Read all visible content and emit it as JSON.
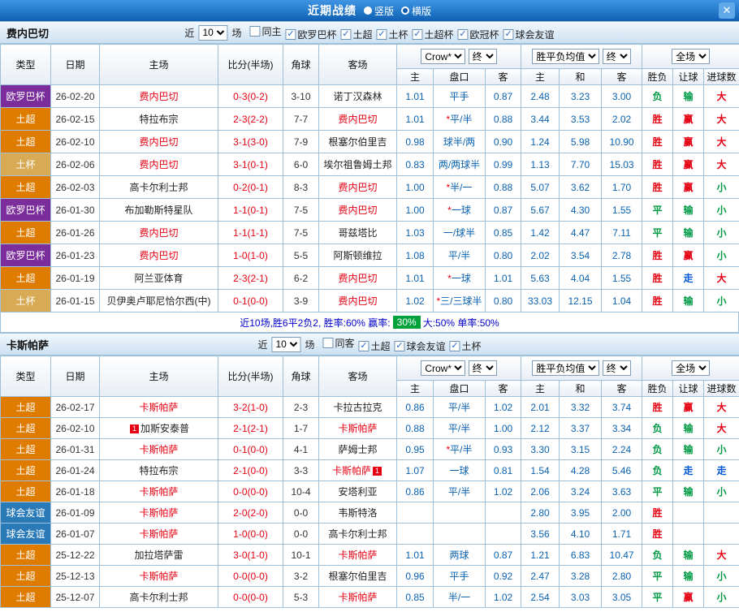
{
  "header": {
    "title": "近期战绩",
    "layout_options": [
      {
        "label": "竖版",
        "selected": false
      },
      {
        "label": "横版",
        "selected": true
      }
    ],
    "close_label": "✕"
  },
  "colors": {
    "type": {
      "欧罗巴杯": "#7c2d9c",
      "土超": "#df7c00",
      "土杯": "#d9aa55",
      "球会友谊": "#2a7ab8"
    },
    "result": {
      "r": "#e60012",
      "g": "#009944",
      "b": "#0056d6"
    },
    "accent_blue": "#0a62b0",
    "score_red": "#e60012"
  },
  "table_header": {
    "type": "类型",
    "date": "日期",
    "home": "主场",
    "score": "比分(半场)",
    "corner": "角球",
    "away": "客场",
    "odds_select": "Crow*",
    "odds_final": "终",
    "avg_select": "胜平负均值",
    "avg_final": "终",
    "full_select": "全场",
    "odds_subs": [
      "主",
      "盘口",
      "客"
    ],
    "avg_subs": [
      "主",
      "和",
      "客"
    ],
    "full_subs": [
      "胜负",
      "让球",
      "进球数"
    ]
  },
  "sections": [
    {
      "team": "费内巴切",
      "near_label": "近",
      "near_value": "10",
      "games_label": "场",
      "filters": [
        {
          "label": "同主",
          "checked": false
        },
        {
          "label": "欧罗巴杯",
          "checked": true
        },
        {
          "label": "土超",
          "checked": true
        },
        {
          "label": "土杯",
          "checked": true
        },
        {
          "label": "土超杯",
          "checked": true
        },
        {
          "label": "欧冠杯",
          "checked": true
        },
        {
          "label": "球会友谊",
          "checked": true
        }
      ],
      "rows": [
        {
          "type": "欧罗巴杯",
          "date": "26-02-20",
          "home": {
            "name": "费内巴切",
            "focus": true
          },
          "score": "0-3(0-2)",
          "corner": "3-10",
          "away": {
            "name": "诺丁汉森林"
          },
          "odds": [
            "1.01",
            "平手",
            "0.87"
          ],
          "avg": [
            "2.48",
            "3.23",
            "3.00"
          ],
          "results": [
            {
              "t": "负",
              "c": "g"
            },
            {
              "t": "输",
              "c": "g"
            },
            {
              "t": "大",
              "c": "r"
            }
          ]
        },
        {
          "type": "土超",
          "date": "26-02-15",
          "home": {
            "name": "特拉布宗"
          },
          "score": "2-3(2-2)",
          "corner": "7-7",
          "away": {
            "name": "费内巴切",
            "focus": true
          },
          "odds": [
            "1.01",
            "*平/半",
            "0.88"
          ],
          "avg": [
            "3.44",
            "3.53",
            "2.02"
          ],
          "results": [
            {
              "t": "胜",
              "c": "r"
            },
            {
              "t": "赢",
              "c": "r"
            },
            {
              "t": "大",
              "c": "r"
            }
          ]
        },
        {
          "type": "土超",
          "date": "26-02-10",
          "home": {
            "name": "费内巴切",
            "focus": true
          },
          "score": "3-1(3-0)",
          "corner": "7-9",
          "away": {
            "name": "根塞尔伯里吉"
          },
          "odds": [
            "0.98",
            "球半/两",
            "0.90"
          ],
          "avg": [
            "1.24",
            "5.98",
            "10.90"
          ],
          "results": [
            {
              "t": "胜",
              "c": "r"
            },
            {
              "t": "赢",
              "c": "r"
            },
            {
              "t": "大",
              "c": "r"
            }
          ]
        },
        {
          "type": "土杯",
          "date": "26-02-06",
          "home": {
            "name": "费内巴切",
            "focus": true
          },
          "score": "3-1(0-1)",
          "corner": "6-0",
          "away": {
            "name": "埃尔祖鲁姆土邦"
          },
          "odds": [
            "0.83",
            "两/两球半",
            "0.99"
          ],
          "avg": [
            "1.13",
            "7.70",
            "15.03"
          ],
          "results": [
            {
              "t": "胜",
              "c": "r"
            },
            {
              "t": "赢",
              "c": "r"
            },
            {
              "t": "大",
              "c": "r"
            }
          ]
        },
        {
          "type": "土超",
          "date": "26-02-03",
          "home": {
            "name": "高卡尔利士邦"
          },
          "score": "0-2(0-1)",
          "corner": "8-3",
          "away": {
            "name": "费内巴切",
            "focus": true
          },
          "odds": [
            "1.00",
            "*半/一",
            "0.88"
          ],
          "avg": [
            "5.07",
            "3.62",
            "1.70"
          ],
          "results": [
            {
              "t": "胜",
              "c": "r"
            },
            {
              "t": "赢",
              "c": "r"
            },
            {
              "t": "小",
              "c": "g"
            }
          ]
        },
        {
          "type": "欧罗巴杯",
          "date": "26-01-30",
          "home": {
            "name": "布加勒斯特星队"
          },
          "score": "1-1(0-1)",
          "corner": "7-5",
          "away": {
            "name": "费内巴切",
            "focus": true
          },
          "odds": [
            "1.00",
            "*一球",
            "0.87"
          ],
          "avg": [
            "5.67",
            "4.30",
            "1.55"
          ],
          "results": [
            {
              "t": "平",
              "c": "g"
            },
            {
              "t": "输",
              "c": "g"
            },
            {
              "t": "小",
              "c": "g"
            }
          ]
        },
        {
          "type": "土超",
          "date": "26-01-26",
          "home": {
            "name": "费内巴切",
            "focus": true
          },
          "score": "1-1(1-1)",
          "corner": "7-5",
          "away": {
            "name": "哥兹塔比"
          },
          "odds": [
            "1.03",
            "一/球半",
            "0.85"
          ],
          "avg": [
            "1.42",
            "4.47",
            "7.11"
          ],
          "results": [
            {
              "t": "平",
              "c": "g"
            },
            {
              "t": "输",
              "c": "g"
            },
            {
              "t": "小",
              "c": "g"
            }
          ]
        },
        {
          "type": "欧罗巴杯",
          "date": "26-01-23",
          "home": {
            "name": "费内巴切",
            "focus": true
          },
          "score": "1-0(1-0)",
          "corner": "5-5",
          "away": {
            "name": "阿斯顿维拉"
          },
          "odds": [
            "1.08",
            "平/半",
            "0.80"
          ],
          "avg": [
            "2.02",
            "3.54",
            "2.78"
          ],
          "results": [
            {
              "t": "胜",
              "c": "r"
            },
            {
              "t": "赢",
              "c": "r"
            },
            {
              "t": "小",
              "c": "g"
            }
          ]
        },
        {
          "type": "土超",
          "date": "26-01-19",
          "home": {
            "name": "阿兰亚体育"
          },
          "score": "2-3(2-1)",
          "corner": "6-2",
          "away": {
            "name": "费内巴切",
            "focus": true
          },
          "odds": [
            "1.01",
            "*一球",
            "1.01"
          ],
          "avg": [
            "5.63",
            "4.04",
            "1.55"
          ],
          "results": [
            {
              "t": "胜",
              "c": "r"
            },
            {
              "t": "走",
              "c": "b"
            },
            {
              "t": "大",
              "c": "r"
            }
          ]
        },
        {
          "type": "土杯",
          "date": "26-01-15",
          "home": {
            "name": "贝伊奥卢耶尼恰尔西(中)"
          },
          "score": "0-1(0-0)",
          "corner": "3-9",
          "away": {
            "name": "费内巴切",
            "focus": true
          },
          "odds": [
            "1.02",
            "*三/三球半",
            "0.80"
          ],
          "avg": [
            "33.03",
            "12.15",
            "1.04"
          ],
          "results": [
            {
              "t": "胜",
              "c": "r"
            },
            {
              "t": "输",
              "c": "g"
            },
            {
              "t": "小",
              "c": "g"
            }
          ]
        }
      ],
      "summary": [
        {
          "text": "近10场,胜6平2负2, 胜率:60% 赢率: ",
          "highlight": false
        },
        {
          "text": "30%",
          "highlight": true
        },
        {
          "text": " 大:50% 单率:50%",
          "highlight": false
        }
      ]
    },
    {
      "team": "卡斯帕萨",
      "near_label": "近",
      "near_value": "10",
      "games_label": "场",
      "filters": [
        {
          "label": "同客",
          "checked": false
        },
        {
          "label": "土超",
          "checked": true
        },
        {
          "label": "球会友谊",
          "checked": true
        },
        {
          "label": "土杯",
          "checked": true
        }
      ],
      "rows": [
        {
          "type": "土超",
          "date": "26-02-17",
          "home": {
            "name": "卡斯帕萨",
            "focus": true
          },
          "score": "3-2(1-0)",
          "corner": "2-3",
          "away": {
            "name": "卡拉古拉克"
          },
          "odds": [
            "0.86",
            "平/半",
            "1.02"
          ],
          "avg": [
            "2.01",
            "3.32",
            "3.74"
          ],
          "results": [
            {
              "t": "胜",
              "c": "r"
            },
            {
              "t": "赢",
              "c": "r"
            },
            {
              "t": "大",
              "c": "r"
            }
          ]
        },
        {
          "type": "土超",
          "date": "26-02-10",
          "home": {
            "name": "加斯安泰普",
            "card_pre": "1"
          },
          "score": "2-1(2-1)",
          "corner": "1-7",
          "away": {
            "name": "卡斯帕萨",
            "focus": true
          },
          "odds": [
            "0.88",
            "平/半",
            "1.00"
          ],
          "avg": [
            "2.12",
            "3.37",
            "3.34"
          ],
          "results": [
            {
              "t": "负",
              "c": "g"
            },
            {
              "t": "输",
              "c": "g"
            },
            {
              "t": "大",
              "c": "r"
            }
          ]
        },
        {
          "type": "土超",
          "date": "26-01-31",
          "home": {
            "name": "卡斯帕萨",
            "focus": true
          },
          "score": "0-1(0-0)",
          "corner": "4-1",
          "away": {
            "name": "萨姆士邦"
          },
          "odds": [
            "0.95",
            "*平/半",
            "0.93"
          ],
          "avg": [
            "3.30",
            "3.15",
            "2.24"
          ],
          "results": [
            {
              "t": "负",
              "c": "g"
            },
            {
              "t": "输",
              "c": "g"
            },
            {
              "t": "小",
              "c": "g"
            }
          ]
        },
        {
          "type": "土超",
          "date": "26-01-24",
          "home": {
            "name": "特拉布宗"
          },
          "score": "2-1(0-0)",
          "corner": "3-3",
          "away": {
            "name": "卡斯帕萨",
            "focus": true,
            "card_post": "1"
          },
          "odds": [
            "1.07",
            "一球",
            "0.81"
          ],
          "avg": [
            "1.54",
            "4.28",
            "5.46"
          ],
          "results": [
            {
              "t": "负",
              "c": "g"
            },
            {
              "t": "走",
              "c": "b"
            },
            {
              "t": "走",
              "c": "b"
            }
          ]
        },
        {
          "type": "土超",
          "date": "26-01-18",
          "home": {
            "name": "卡斯帕萨",
            "focus": true
          },
          "score": "0-0(0-0)",
          "corner": "10-4",
          "away": {
            "name": "安塔利亚"
          },
          "odds": [
            "0.86",
            "平/半",
            "1.02"
          ],
          "avg": [
            "2.06",
            "3.24",
            "3.63"
          ],
          "results": [
            {
              "t": "平",
              "c": "g"
            },
            {
              "t": "输",
              "c": "g"
            },
            {
              "t": "小",
              "c": "g"
            }
          ]
        },
        {
          "type": "球会友谊",
          "date": "26-01-09",
          "home": {
            "name": "卡斯帕萨",
            "focus": true
          },
          "score": "2-0(2-0)",
          "corner": "0-0",
          "away": {
            "name": "韦斯特洛"
          },
          "odds": [
            "",
            "",
            ""
          ],
          "avg": [
            "2.80",
            "3.95",
            "2.00"
          ],
          "results": [
            {
              "t": "胜",
              "c": "r"
            },
            {
              "t": "",
              "c": "r"
            },
            {
              "t": "",
              "c": "r"
            }
          ]
        },
        {
          "type": "球会友谊",
          "date": "26-01-07",
          "home": {
            "name": "卡斯帕萨",
            "focus": true
          },
          "score": "1-0(0-0)",
          "corner": "0-0",
          "away": {
            "name": "高卡尔利士邦"
          },
          "odds": [
            "",
            "",
            ""
          ],
          "avg": [
            "3.56",
            "4.10",
            "1.71"
          ],
          "results": [
            {
              "t": "胜",
              "c": "r"
            },
            {
              "t": "",
              "c": "r"
            },
            {
              "t": "",
              "c": "r"
            }
          ]
        },
        {
          "type": "土超",
          "date": "25-12-22",
          "home": {
            "name": "加拉塔萨雷"
          },
          "score": "3-0(1-0)",
          "corner": "10-1",
          "away": {
            "name": "卡斯帕萨",
            "focus": true
          },
          "odds": [
            "1.01",
            "两球",
            "0.87"
          ],
          "avg": [
            "1.21",
            "6.83",
            "10.47"
          ],
          "results": [
            {
              "t": "负",
              "c": "g"
            },
            {
              "t": "输",
              "c": "g"
            },
            {
              "t": "大",
              "c": "r"
            }
          ]
        },
        {
          "type": "土超",
          "date": "25-12-13",
          "home": {
            "name": "卡斯帕萨",
            "focus": true
          },
          "score": "0-0(0-0)",
          "corner": "3-2",
          "away": {
            "name": "根塞尔伯里吉"
          },
          "odds": [
            "0.96",
            "平手",
            "0.92"
          ],
          "avg": [
            "2.47",
            "3.28",
            "2.80"
          ],
          "results": [
            {
              "t": "平",
              "c": "g"
            },
            {
              "t": "输",
              "c": "g"
            },
            {
              "t": "小",
              "c": "g"
            }
          ]
        },
        {
          "type": "土超",
          "date": "25-12-07",
          "home": {
            "name": "高卡尔利士邦"
          },
          "score": "0-0(0-0)",
          "corner": "5-3",
          "away": {
            "name": "卡斯帕萨",
            "focus": true
          },
          "odds": [
            "0.85",
            "半/一",
            "1.02"
          ],
          "avg": [
            "2.54",
            "3.03",
            "3.05"
          ],
          "results": [
            {
              "t": "平",
              "c": "g"
            },
            {
              "t": "赢",
              "c": "r"
            },
            {
              "t": "小",
              "c": "g"
            }
          ]
        }
      ],
      "summary": []
    }
  ]
}
